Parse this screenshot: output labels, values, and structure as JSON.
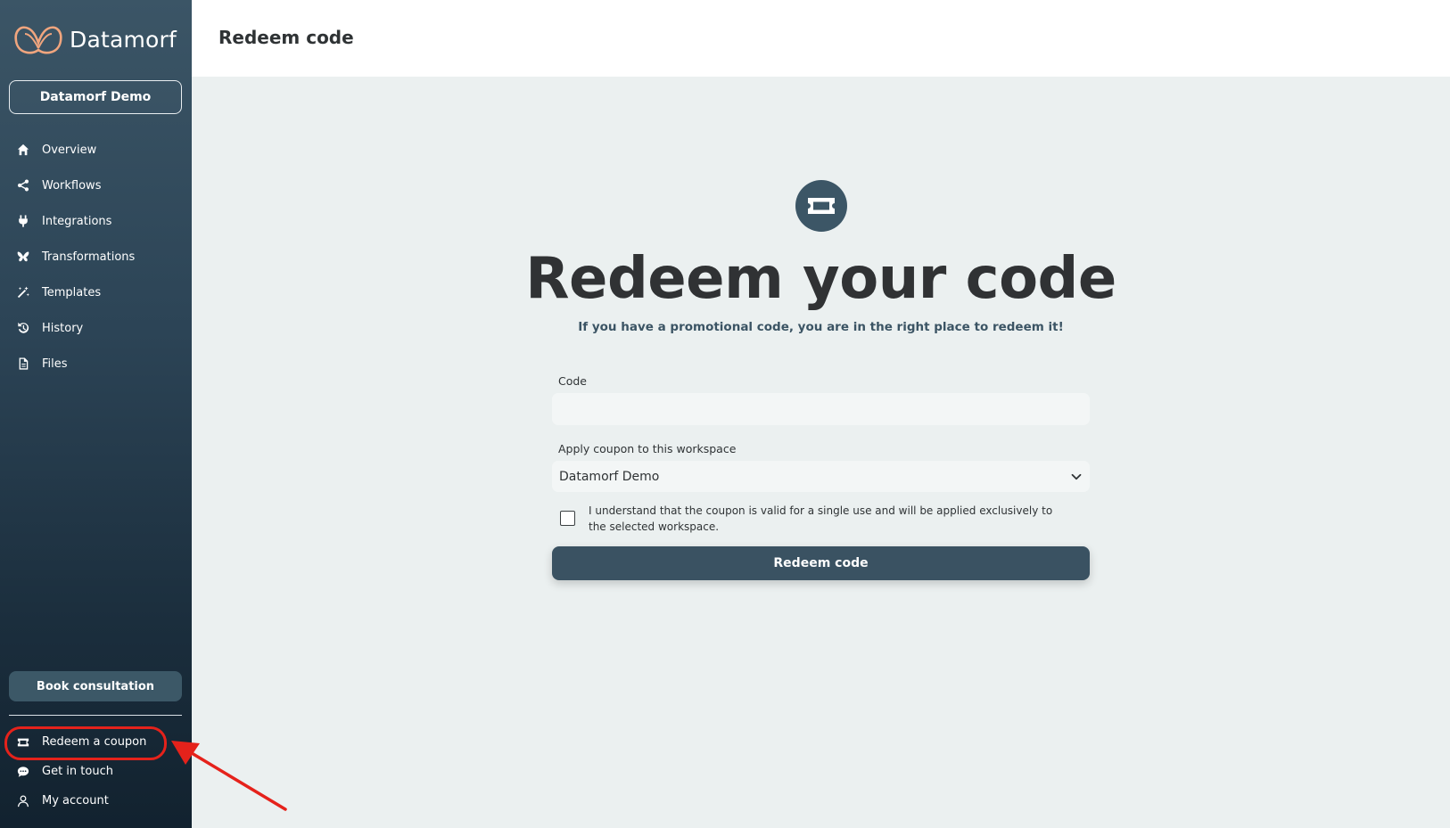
{
  "colors": {
    "sidebar_top": "#3b5566",
    "sidebar_bottom": "#12222f",
    "primary": "#3a5262",
    "background": "#ebf0f0",
    "logo_accent": "#f0a57e",
    "annotation": "#e5221b"
  },
  "sidebar": {
    "logo_text": "Datamorf",
    "workspace_name": "Datamorf Demo",
    "items": [
      {
        "label": "Overview",
        "icon": "home-icon"
      },
      {
        "label": "Workflows",
        "icon": "share-icon"
      },
      {
        "label": "Integrations",
        "icon": "plug-icon"
      },
      {
        "label": "Transformations",
        "icon": "butterfly-icon"
      },
      {
        "label": "Templates",
        "icon": "magic-wand-icon"
      },
      {
        "label": "History",
        "icon": "history-icon"
      },
      {
        "label": "Files",
        "icon": "file-icon"
      }
    ],
    "book_consultation": "Book consultation",
    "bottom_items": [
      {
        "label": "Redeem a coupon",
        "icon": "ticket-icon"
      },
      {
        "label": "Get in touch",
        "icon": "chat-icon"
      },
      {
        "label": "My account",
        "icon": "user-icon"
      }
    ]
  },
  "header": {
    "title": "Redeem code"
  },
  "main": {
    "title": "Redeem your code",
    "subtitle": "If you have a promotional code, you are in the right place to redeem it!",
    "code_label": "Code",
    "code_value": "",
    "workspace_label": "Apply coupon to this workspace",
    "workspace_selected": "Datamorf Demo",
    "consent_text": "I understand that the coupon is valid for a single use and will be applied exclusively to the selected workspace.",
    "consent_checked": false,
    "submit_label": "Redeem code"
  }
}
